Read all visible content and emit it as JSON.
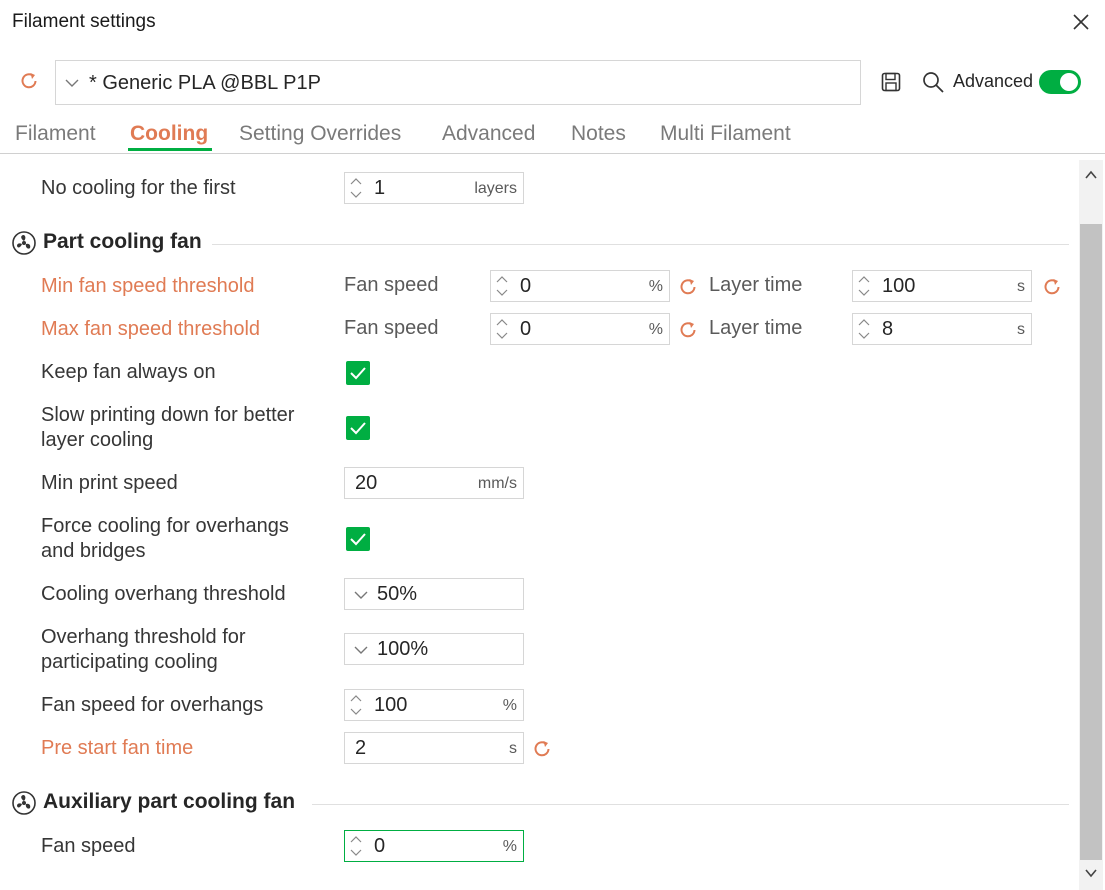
{
  "window": {
    "title": "Filament settings"
  },
  "preset": {
    "name": "* Generic PLA @BBL P1P",
    "advanced_label": "Advanced",
    "advanced_on": true
  },
  "tabs": [
    {
      "label": "Filament",
      "active": false
    },
    {
      "label": "Cooling",
      "active": true
    },
    {
      "label": "Setting Overrides",
      "active": false
    },
    {
      "label": "Advanced",
      "active": false
    },
    {
      "label": "Notes",
      "active": false
    },
    {
      "label": "Multi Filament",
      "active": false
    }
  ],
  "settings": {
    "no_cooling": {
      "label": "No cooling for the first",
      "value": "1",
      "unit": "layers"
    },
    "part_fan": {
      "title": "Part cooling fan",
      "min_threshold": {
        "label": "Min fan speed threshold",
        "fan_label": "Fan speed",
        "fan_value": "0",
        "fan_unit": "%",
        "time_label": "Layer time",
        "time_value": "100",
        "time_unit": "s"
      },
      "max_threshold": {
        "label": "Max fan speed threshold",
        "fan_label": "Fan speed",
        "fan_value": "0",
        "fan_unit": "%",
        "time_label": "Layer time",
        "time_value": "8",
        "time_unit": "s"
      },
      "keep_fan_on": {
        "label": "Keep fan always on",
        "checked": true
      },
      "slow_down": {
        "label_line1": "Slow printing down for better",
        "label_line2": "layer cooling",
        "checked": true
      },
      "min_print_speed": {
        "label": "Min print speed",
        "value": "20",
        "unit": "mm/s"
      },
      "force_cooling": {
        "label_line1": "Force cooling for overhangs",
        "label_line2": "and bridges",
        "checked": true
      },
      "overhang_threshold": {
        "label": "Cooling overhang threshold",
        "value": "50%"
      },
      "overhang_participating": {
        "label_line1": "Overhang threshold for",
        "label_line2": "participating cooling",
        "value": "100%"
      },
      "overhang_fan_speed": {
        "label": "Fan speed for overhangs",
        "value": "100",
        "unit": "%"
      },
      "pre_start_fan": {
        "label": "Pre start fan time",
        "value": "2",
        "unit": "s"
      }
    },
    "aux_fan": {
      "title": "Auxiliary part cooling fan",
      "fan_speed": {
        "label": "Fan speed",
        "value": "0",
        "unit": "%"
      }
    }
  },
  "colors": {
    "accent_green": "#00ae42",
    "modified_orange": "#e07b54",
    "text": "#363636"
  },
  "icons": [
    "reset-icon",
    "chevron-down-icon",
    "save-icon",
    "search-icon",
    "close-icon",
    "fan-icon",
    "spin-icon",
    "check-icon",
    "scroll-up-icon",
    "scroll-down-icon"
  ]
}
